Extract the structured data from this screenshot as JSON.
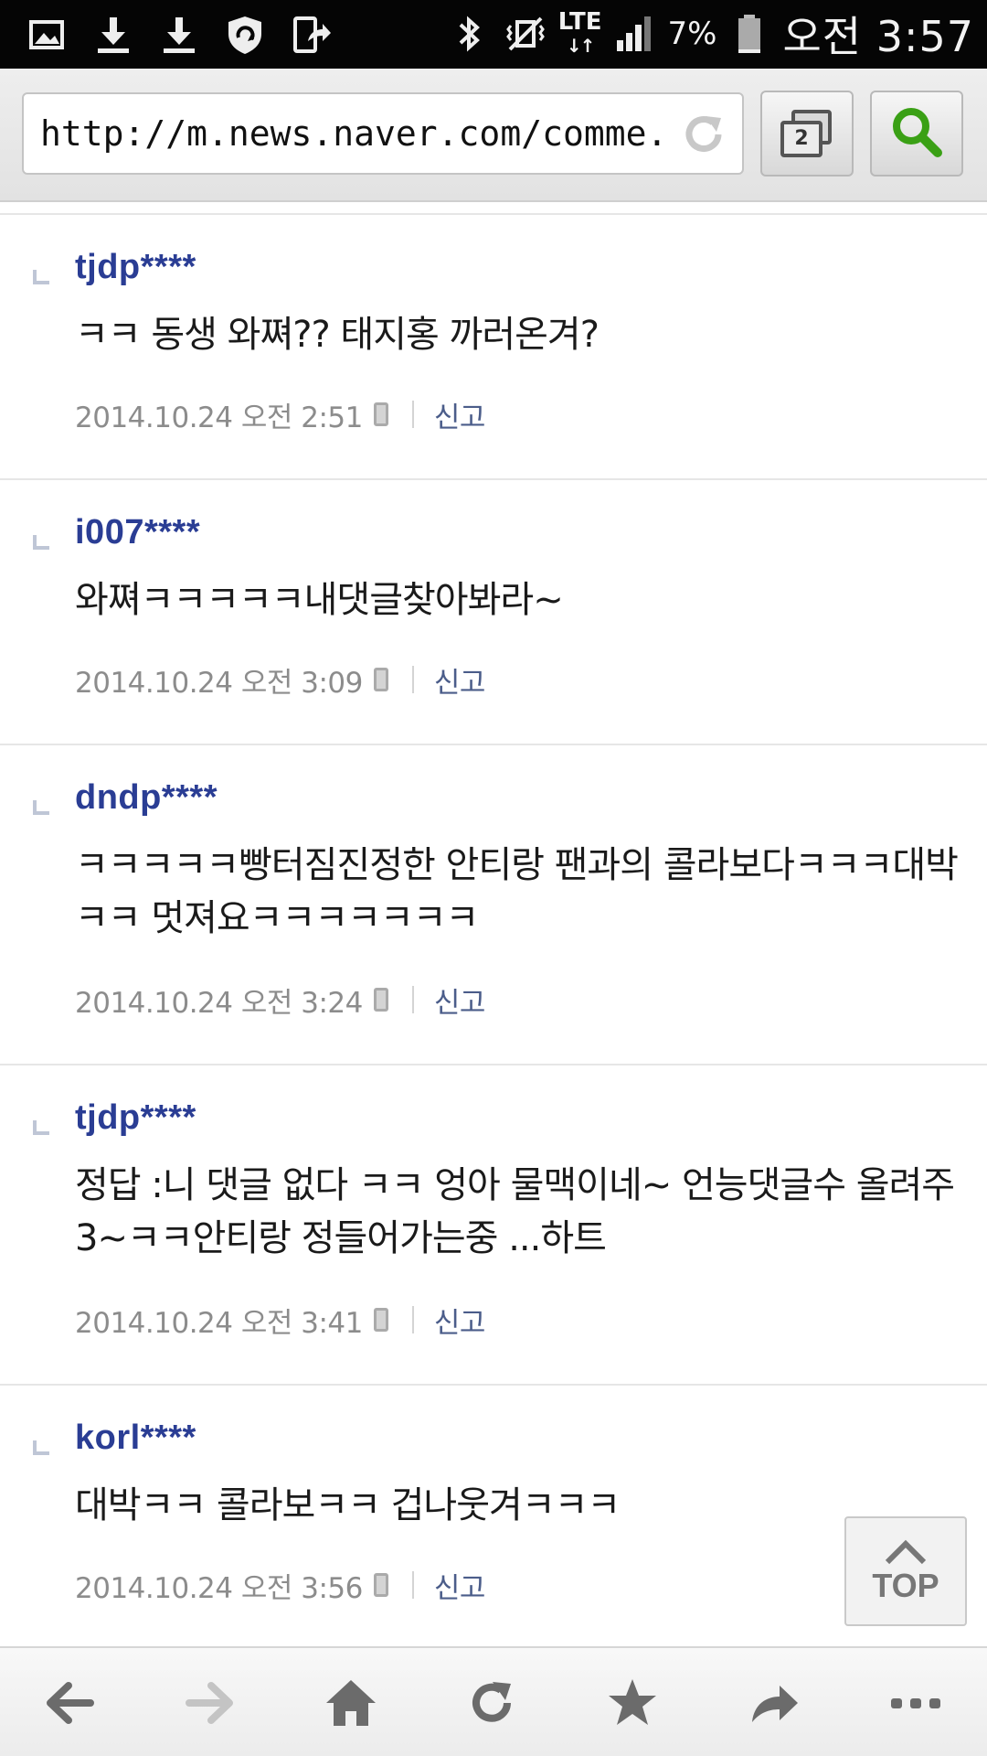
{
  "status_bar": {
    "lte_label": "LTE",
    "lte_arrows": "↓↑",
    "battery_percent": "7%",
    "clock": "오전 3:57",
    "icons": [
      "gallery-icon",
      "download-icon",
      "download-icon",
      "shield-sync-icon",
      "share-device-icon",
      "bluetooth-icon",
      "vibrate-mute-icon",
      "signal-icon",
      "battery-icon"
    ]
  },
  "browser": {
    "url": "http://m.news.naver.com/comme...",
    "tab_count": "2"
  },
  "comments": [
    {
      "user": "tjdp****",
      "body": "ㅋㅋ 동생 와쪄?? 태지홍 까러온겨?",
      "date": "2014.10.24 오전 2:51",
      "report": "신고"
    },
    {
      "user": "i007****",
      "body": "와쪄ㅋㅋㅋㅋㅋ내댓글찾아봐라~",
      "date": "2014.10.24 오전 3:09",
      "report": "신고"
    },
    {
      "user": "dndp****",
      "body": "ㅋㅋㅋㅋㅋ빵터짐진정한 안티랑 팬과의 콜라보다ㅋㅋㅋ대박ㅋㅋ 멋져요ㅋㅋㅋㅋㅋㅋㅋ",
      "date": "2014.10.24 오전 3:24",
      "report": "신고"
    },
    {
      "user": "tjdp****",
      "body": "정답 :니 댓글 없다 ㅋㅋ 엉아 물맥이네~ 언능댓글수 올려주3~ㅋㅋ안티랑 정들어가는중 ...하트",
      "date": "2014.10.24 오전 3:41",
      "report": "신고"
    },
    {
      "user": "korl****",
      "body": "대박ㅋㅋ 콜라보ㅋㅋ 겁나웃겨ㅋㅋㅋ",
      "date": "2014.10.24 오전 3:56",
      "report": "신고"
    }
  ],
  "top_button": {
    "label": "TOP"
  },
  "bottom_bar": {
    "icons": [
      "back-arrow-icon",
      "forward-arrow-icon",
      "home-icon",
      "refresh-icon",
      "bookmark-star-icon",
      "share-arrow-icon",
      "more-dots-icon"
    ]
  }
}
